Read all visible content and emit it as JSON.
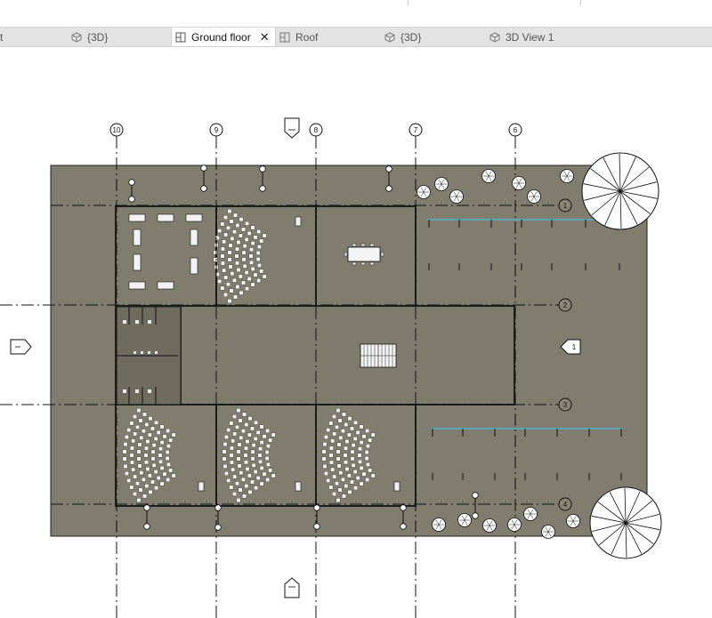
{
  "tabs": [
    {
      "label": "t",
      "icon": "none"
    },
    {
      "label": "{3D}",
      "icon": "3d-view-icon"
    },
    {
      "label": "Ground floor",
      "icon": "floor-plan-icon",
      "active": true
    },
    {
      "label": "Roof",
      "icon": "floor-plan-icon"
    },
    {
      "label": "{3D}",
      "icon": "3d-view-icon"
    },
    {
      "label": "3D View 1",
      "icon": "3d-view-icon"
    }
  ],
  "close_glyph": "✕",
  "grid": {
    "vertical": [
      "10",
      "9",
      "8",
      "7",
      "6"
    ],
    "horizontal": [
      "1",
      "2",
      "3",
      "4"
    ]
  },
  "elevation_marker_label": "1",
  "colors": {
    "site_fill": "#807c6e",
    "room_fill": "#7f7b6c",
    "wall": "#1e1e1e",
    "tab_bar": "#e3e3e3",
    "accent_line": "#4fb3c8"
  }
}
